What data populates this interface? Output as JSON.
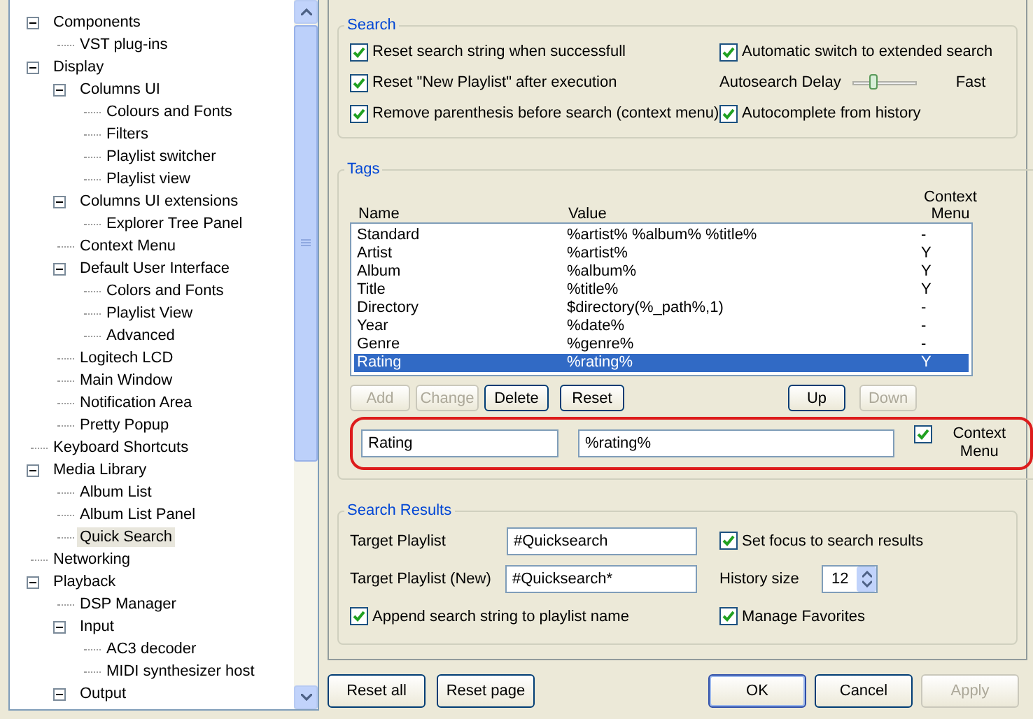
{
  "tree": {
    "items": [
      {
        "label": "Components",
        "expanded": true,
        "selected": false,
        "children": [
          {
            "label": "VST plug-ins",
            "selected": false
          }
        ]
      },
      {
        "label": "Display",
        "expanded": true,
        "selected": false,
        "children": [
          {
            "label": "Columns UI",
            "expanded": true,
            "selected": false,
            "children": [
              {
                "label": "Colours and Fonts",
                "selected": false
              },
              {
                "label": "Filters",
                "selected": false
              },
              {
                "label": "Playlist switcher",
                "selected": false
              },
              {
                "label": "Playlist view",
                "selected": false
              }
            ]
          },
          {
            "label": "Columns UI extensions",
            "expanded": true,
            "selected": false,
            "children": [
              {
                "label": "Explorer Tree Panel",
                "selected": false
              }
            ]
          },
          {
            "label": "Context Menu",
            "selected": false
          },
          {
            "label": "Default User Interface",
            "expanded": true,
            "selected": false,
            "children": [
              {
                "label": "Colors and Fonts",
                "selected": false
              },
              {
                "label": "Playlist View",
                "selected": false
              },
              {
                "label": "Advanced",
                "selected": false
              }
            ]
          },
          {
            "label": "Logitech LCD",
            "selected": false
          },
          {
            "label": "Main Window",
            "selected": false
          },
          {
            "label": "Notification Area",
            "selected": false
          },
          {
            "label": "Pretty Popup",
            "selected": false
          }
        ]
      },
      {
        "label": "Keyboard Shortcuts",
        "selected": false
      },
      {
        "label": "Media Library",
        "expanded": true,
        "selected": false,
        "children": [
          {
            "label": "Album List",
            "selected": false
          },
          {
            "label": "Album List Panel",
            "selected": false
          },
          {
            "label": "Quick Search",
            "selected": true
          }
        ]
      },
      {
        "label": "Networking",
        "selected": false
      },
      {
        "label": "Playback",
        "expanded": true,
        "selected": false,
        "children": [
          {
            "label": "DSP Manager",
            "selected": false
          },
          {
            "label": "Input",
            "expanded": true,
            "selected": false,
            "children": [
              {
                "label": "AC3 decoder",
                "selected": false
              },
              {
                "label": "MIDI synthesizer host",
                "selected": false
              }
            ]
          },
          {
            "label": "Output",
            "expanded": true,
            "selected": false
          }
        ]
      }
    ]
  },
  "search": {
    "title": "Search",
    "left": [
      {
        "label": "Reset search string when successfull",
        "checked": true
      },
      {
        "label": "Reset \"New Playlist\" after execution",
        "checked": true
      },
      {
        "label": "Remove parenthesis before search (context menu)",
        "checked": true
      }
    ],
    "right": [
      {
        "kind": "checkbox",
        "label": "Automatic switch to extended search",
        "checked": true
      },
      {
        "kind": "slider",
        "label": "Autosearch Delay",
        "level": 0.3,
        "end_label": "Fast"
      },
      {
        "kind": "checkbox",
        "label": "Autocomplete from history",
        "checked": true
      }
    ]
  },
  "tags": {
    "title": "Tags",
    "columns": [
      "Name",
      "Value",
      "Context Menu"
    ],
    "rows": [
      {
        "cells": [
          "Standard",
          "%artist% %album% %title%",
          "-"
        ],
        "selected": false
      },
      {
        "cells": [
          "Artist",
          "%artist%",
          "Y"
        ],
        "selected": false
      },
      {
        "cells": [
          "Album",
          "%album%",
          "Y"
        ],
        "selected": false
      },
      {
        "cells": [
          "Title",
          "%title%",
          "Y"
        ],
        "selected": false
      },
      {
        "cells": [
          "Directory",
          "$directory(%_path%,1)",
          "-"
        ],
        "selected": false
      },
      {
        "cells": [
          "Year",
          "%date%",
          "-"
        ],
        "selected": false
      },
      {
        "cells": [
          "Genre",
          "%genre%",
          "-"
        ],
        "selected": false
      },
      {
        "cells": [
          "Rating",
          "%rating%",
          "Y"
        ],
        "selected": true
      }
    ],
    "buttons_left": [
      {
        "label": "Add",
        "disabled": true
      },
      {
        "label": "Change",
        "disabled": true
      },
      {
        "label": "Delete",
        "disabled": false
      },
      {
        "label": "Reset",
        "disabled": false
      }
    ],
    "buttons_right": [
      {
        "label": "Up",
        "disabled": false
      },
      {
        "label": "Down",
        "disabled": true
      }
    ],
    "edit": {
      "name": "Rating",
      "value": "%rating%",
      "checkbox": {
        "label": "Context Menu",
        "checked": true
      }
    }
  },
  "results": {
    "title": "Search Results",
    "target": {
      "label": "Target Playlist",
      "value": "#Quicksearch"
    },
    "target_new": {
      "label": "Target Playlist (New)",
      "value": "#Quicksearch*"
    },
    "append": {
      "label": "Append search string to playlist name",
      "checked": true
    },
    "focus": {
      "label": "Set focus to search results",
      "checked": true
    },
    "history": {
      "label": "History size",
      "value": "12"
    },
    "favorites": {
      "label": "Manage Favorites",
      "checked": true
    }
  },
  "footer": {
    "left": [
      {
        "label": "Reset all",
        "disabled": false
      },
      {
        "label": "Reset page",
        "disabled": false
      }
    ],
    "right": [
      {
        "label": "OK",
        "disabled": false,
        "default": true
      },
      {
        "label": "Cancel",
        "disabled": false,
        "default": false
      },
      {
        "label": "Apply",
        "disabled": true,
        "default": false
      }
    ]
  }
}
